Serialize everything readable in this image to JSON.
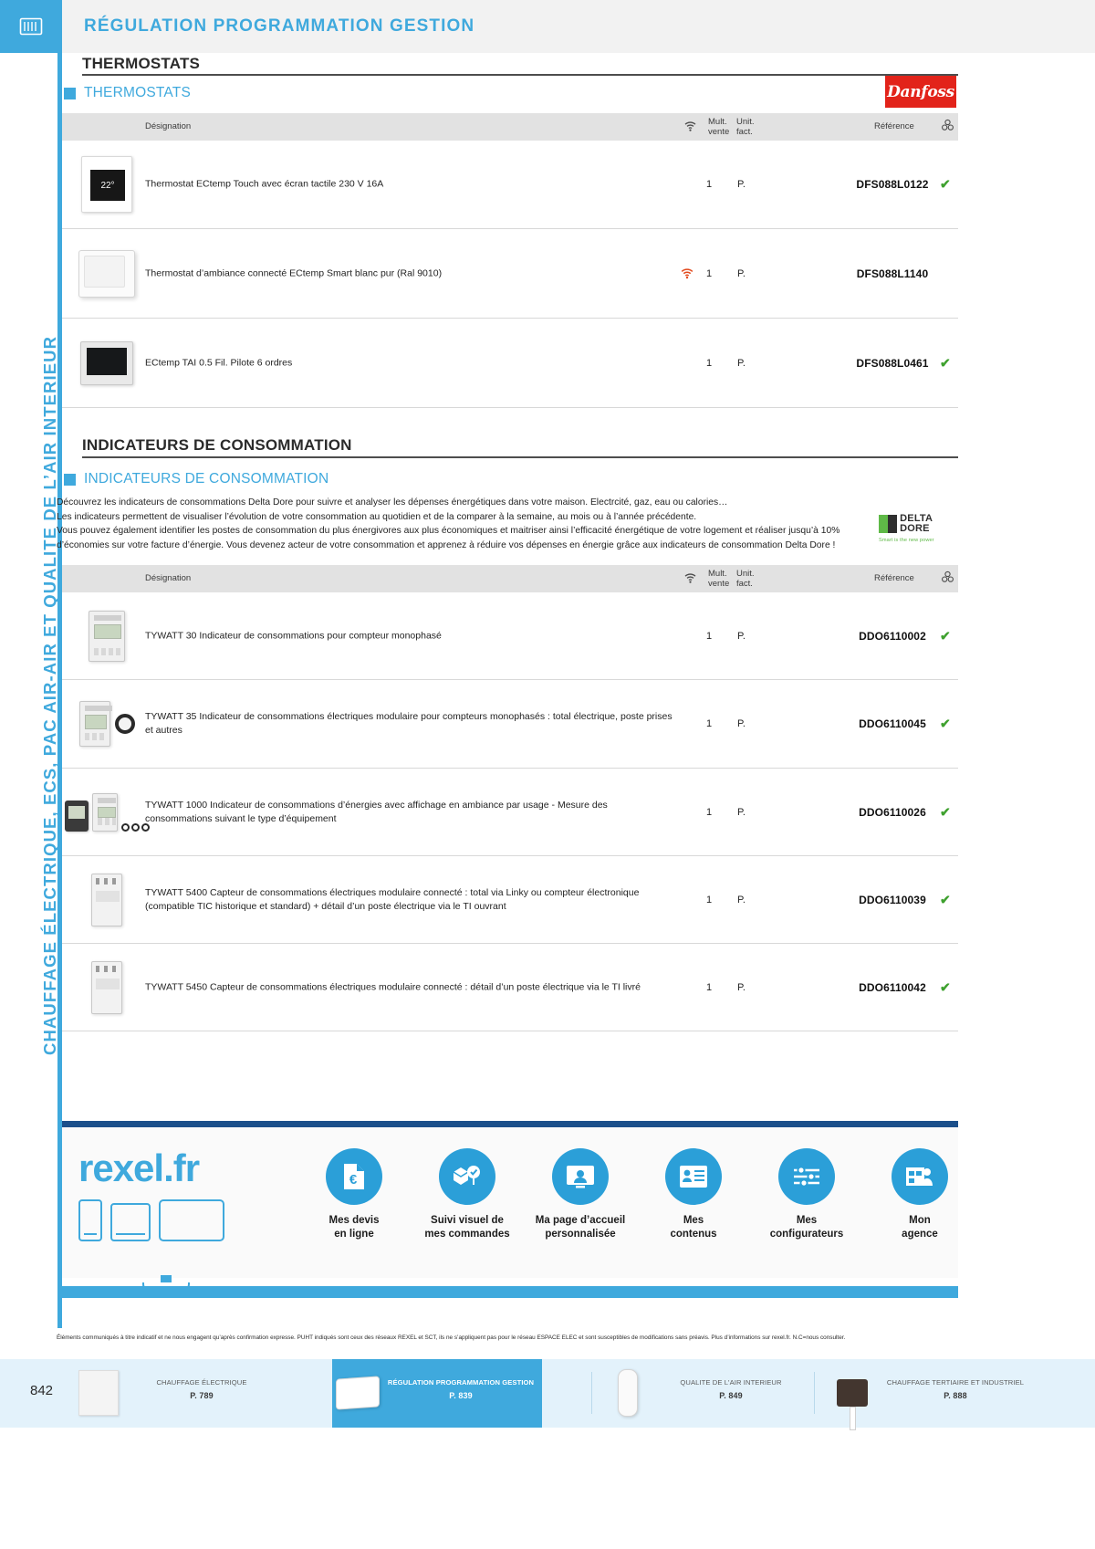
{
  "spine": {
    "label": "CHAUFFAGE ÉLECTRIQUE, ECS, PAC AIR-AIR ET QUALITE DE L’AIR INTERIEUR",
    "icon": "radiator-icon"
  },
  "header": {
    "title": "RÉGULATION PROGRAMMATION GESTION"
  },
  "sections": [
    {
      "title": "THERMOSTATS",
      "subhead": "THERMOSTATS",
      "brand": {
        "name": "Danfoss",
        "color": "#e2231a"
      },
      "columns": {
        "designation": "Désignation",
        "wifi": "wifi-icon",
        "mult": "Mult.\nvente",
        "mult_l1": "Mult.",
        "mult_l2": "vente",
        "unit_l1": "Unit.",
        "unit_l2": "fact.",
        "reference": "Référence",
        "stock": "stock-icon"
      },
      "rows": [
        {
          "designation": "Thermostat ECtemp Touch avec écran tactile 230 V 16A",
          "connected": false,
          "mult": "1",
          "unit": "P.",
          "reference": "DFS088L0122",
          "available": "✔",
          "thumb": "thermostat-touch"
        },
        {
          "designation": "Thermostat d’ambiance connecté ECtemp Smart blanc pur (Ral 9010)",
          "connected": true,
          "mult": "1",
          "unit": "P.",
          "reference": "DFS088L1140",
          "available": "",
          "thumb": "thermostat-smart"
        },
        {
          "designation": "ECtemp TAI 0.5 Fil. Pilote 6 ordres",
          "connected": false,
          "mult": "1",
          "unit": "P.",
          "reference": "DFS088L0461",
          "available": "✔",
          "thumb": "thermostat-tai"
        }
      ]
    },
    {
      "title": "INDICATEURS DE CONSOMMATION",
      "subhead": "INDICATEURS DE CONSOMMATION",
      "brand": {
        "name": "DELTA DORE",
        "tagline": "Smart is the new power"
      },
      "intro": [
        "Découvrez les indicateurs de consommations Delta Dore pour suivre et analyser les dépenses énergétiques dans votre maison. Electrcité, gaz, eau ou calories…",
        "Les indicateurs permettent de visualiser l’évolution de votre consommation au quotidien et de la comparer à la semaine, au mois ou à l’année précédente.",
        "Vous pouvez également identifier les postes de consommation du plus énergivores aux plus économiques et maitriser ainsi l’efficacité énergétique de votre logement et réaliser jusqu’à 10%",
        "d’économies sur votre facture d’énergie. Vous devenez acteur de votre consommation et apprenez à réduire vos dépenses en énergie grâce aux indicateurs de consommation Delta Dore !"
      ],
      "columns": {
        "designation": "Désignation",
        "wifi": "wifi-icon",
        "mult_l1": "Mult.",
        "mult_l2": "vente",
        "unit_l1": "Unit.",
        "unit_l2": "fact.",
        "reference": "Référence",
        "stock": "stock-icon"
      },
      "rows": [
        {
          "designation": "TYWATT 30 Indicateur de consommations pour compteur monophasé",
          "connected": false,
          "mult": "1",
          "unit": "P.",
          "reference": "DDO6110002",
          "available": "✔",
          "thumb": "tywatt-din"
        },
        {
          "designation": "TYWATT 35 Indicateur de consommations électriques modulaire pour compteurs monophasés : total électrique, poste prises et autres",
          "connected": false,
          "mult": "1",
          "unit": "P.",
          "reference": "DDO6110045",
          "available": "✔",
          "thumb": "tywatt-din-ct"
        },
        {
          "designation": "TYWATT 1000 Indicateur de consommations d’énergies avec affichage en ambiance par usage - Mesure des consommations suivant le type d’équipement",
          "connected": false,
          "mult": "1",
          "unit": "P.",
          "reference": "DDO6110026",
          "available": "✔",
          "thumb": "tywatt-1000"
        },
        {
          "designation": "TYWATT 5400 Capteur de consommations électriques modulaire connecté : total via Linky ou compteur électronique (compatible TIC historique et standard) + détail d’un poste électrique via le TI ouvrant",
          "connected": false,
          "mult": "1",
          "unit": "P.",
          "reference": "DDO6110039",
          "available": "✔",
          "thumb": "tywatt-module"
        },
        {
          "designation": "TYWATT 5450 Capteur de consommations électriques modulaire connecté : détail d’un poste électrique via le TI livré",
          "connected": false,
          "mult": "1",
          "unit": "P.",
          "reference": "DDO6110042",
          "available": "✔",
          "thumb": "tywatt-module"
        }
      ]
    }
  ],
  "promo": {
    "brand": "rexel.fr",
    "features": [
      {
        "icon": "invoice-euro-icon",
        "l1": "Mes devis",
        "l2": "en ligne"
      },
      {
        "icon": "package-tracking-icon",
        "l1": "Suivi visuel de",
        "l2": "mes commandes"
      },
      {
        "icon": "personal-home-icon",
        "l1": "Ma page d’accueil",
        "l2": "personnalisée"
      },
      {
        "icon": "content-list-icon",
        "l1": "Mes",
        "l2": "contenus"
      },
      {
        "icon": "sliders-icon",
        "l1": "Mes",
        "l2": "configurateurs"
      },
      {
        "icon": "store-agent-icon",
        "l1": "Mon",
        "l2": "agence"
      }
    ]
  },
  "legal": "Éléments communiqués à titre indicatif et ne nous engagent qu’après confirmation expresse. PUHT indiqués sont ceux des réseaux REXEL et SCT, ils ne s’appliquent pas pour le réseau ESPACE ELEC et sont susceptibles de modifications sans préavis. Plus d’informations sur rexel.fr. N.C=nous consulter.",
  "bottom_nav": {
    "page_number": "842",
    "items": [
      {
        "label": "CHAUFFAGE ÉLECTRIQUE",
        "page": "P. 789",
        "active": false,
        "thumb": "panel-heater"
      },
      {
        "label": "RÉGULATION PROGRAMMATION GESTION",
        "page": "P. 839",
        "active": true,
        "thumb": "thermostat"
      },
      {
        "label": "QUALITE DE L'AIR INTERIEUR",
        "page": "P. 849",
        "active": false,
        "thumb": "air-vent"
      },
      {
        "label": "CHAUFFAGE TERTIAIRE ET INDUSTRIEL",
        "page": "P. 888",
        "active": false,
        "thumb": "industrial-heater"
      }
    ]
  }
}
